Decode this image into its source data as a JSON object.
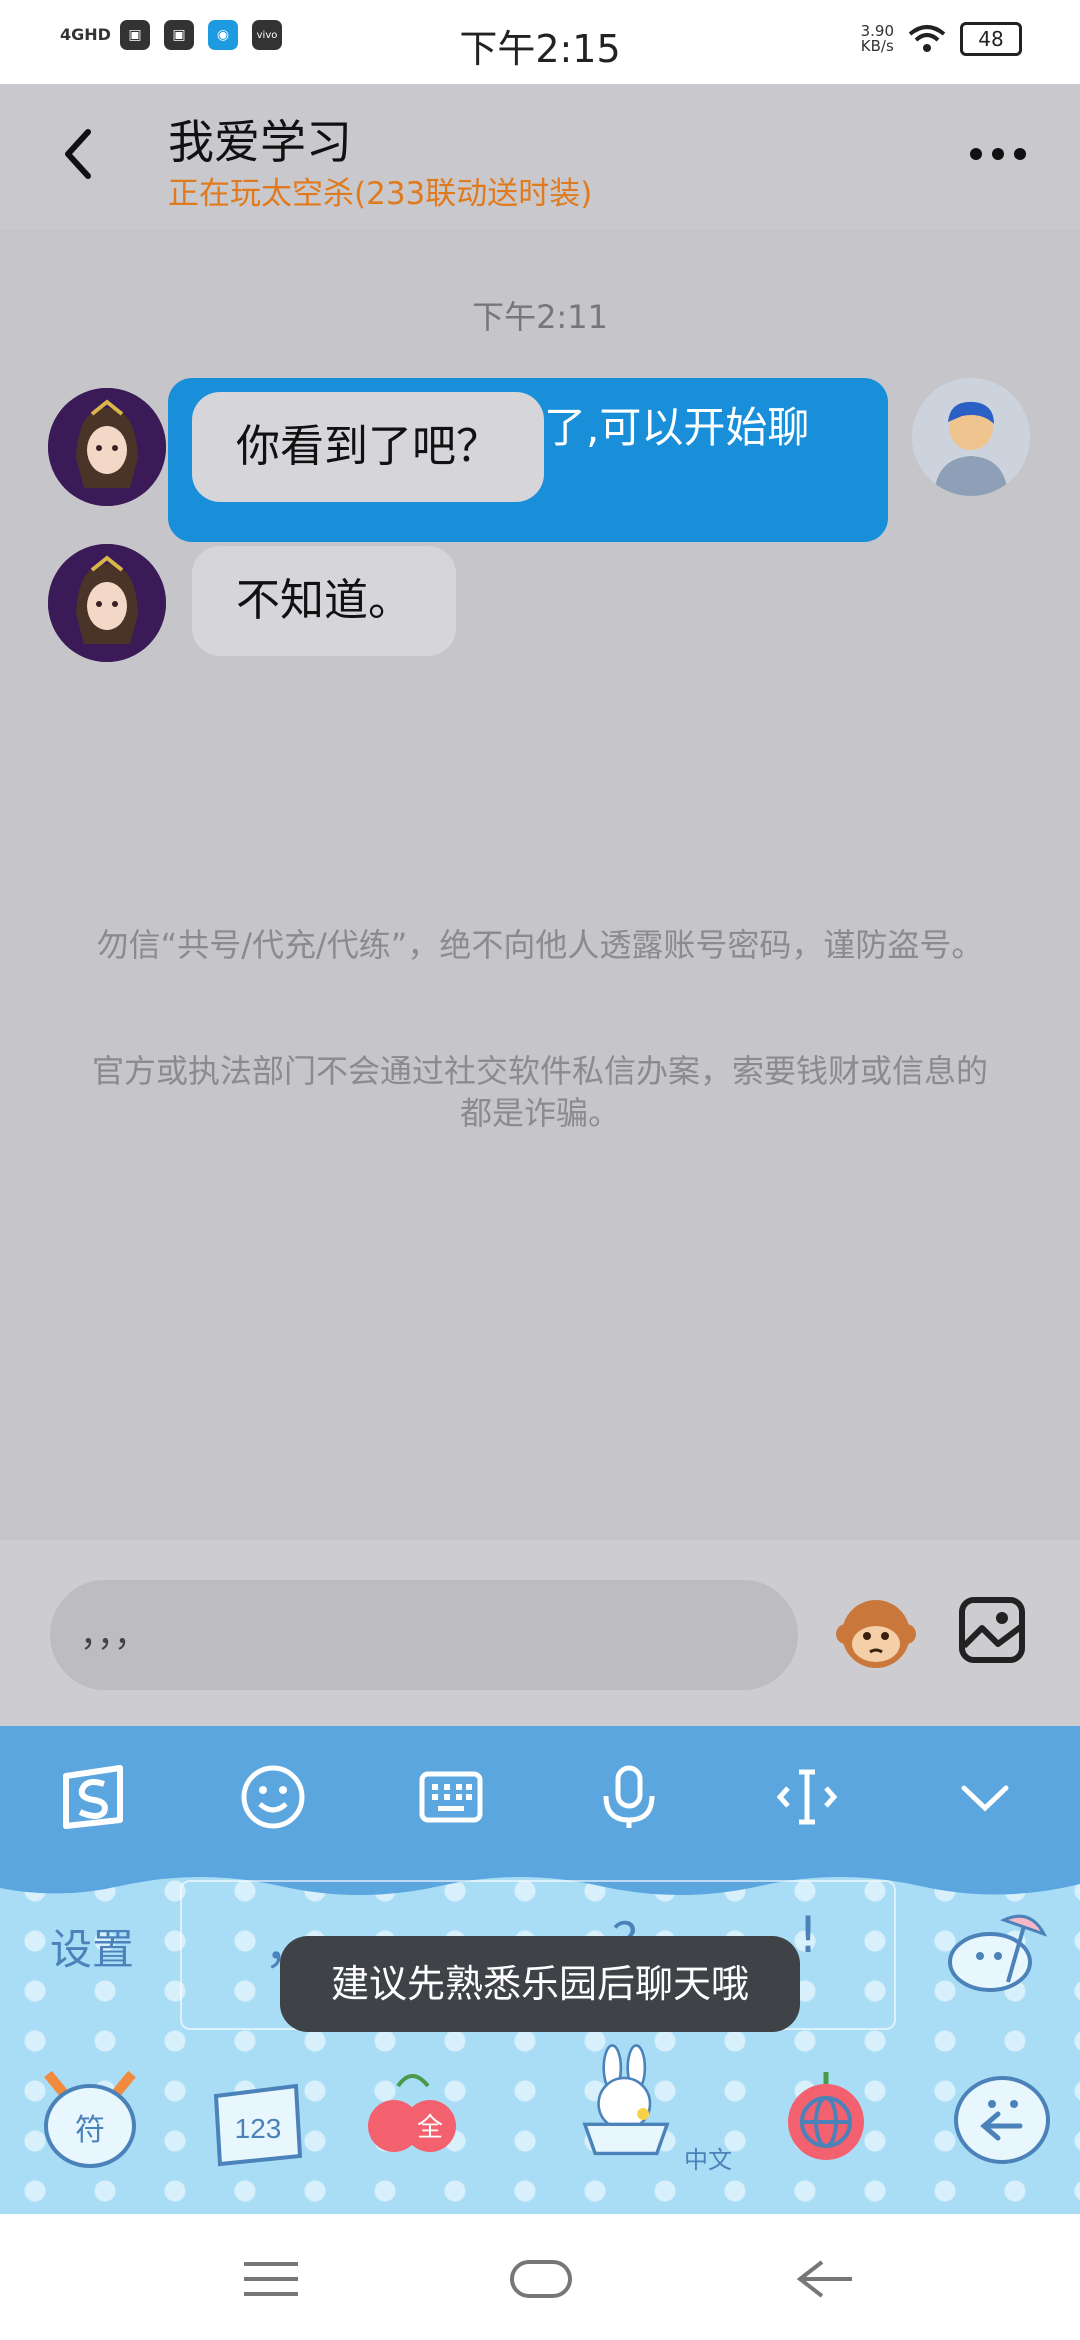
{
  "status_bar": {
    "network": "4GHD",
    "time": "下午2:15",
    "speed_value": "3.90",
    "speed_unit": "KB/s",
    "battery": "48",
    "app_icons": [
      "message-icon",
      "message-icon",
      "qq-icon",
      "vivo-icon"
    ]
  },
  "header": {
    "title": "我爱学习",
    "subtitle": "正在玩太空杀(233联动送时装)"
  },
  "chat": {
    "timestamp": "下午2:11",
    "messages": [
      {
        "from": "self",
        "text": "我们已经成为好友了,可以开始聊天啦~"
      },
      {
        "from": "peer",
        "text": "你看到了吧？"
      },
      {
        "from": "peer",
        "text": "不知道。"
      }
    ],
    "notices": [
      "勿信“共号/代充/代练”，绝不向他人透露账号密码，谨防盗号。",
      "官方或执法部门不会通过社交软件私信办案，索要钱财或信息的都是诈骗。"
    ]
  },
  "input": {
    "value": "，，，"
  },
  "keyboard": {
    "settings_label": "设置",
    "candidate_1": "，",
    "candidate_2": "？",
    "candidate_3": "!",
    "toast": "建议先熟悉乐园后聊天哦",
    "language_label": "中文"
  },
  "colors": {
    "bubble_out": "#1a8fd9",
    "subtitle": "#e07a1f",
    "keyboard_toolbar": "#5ba6df",
    "keyboard_body": "#a9ddf6"
  }
}
